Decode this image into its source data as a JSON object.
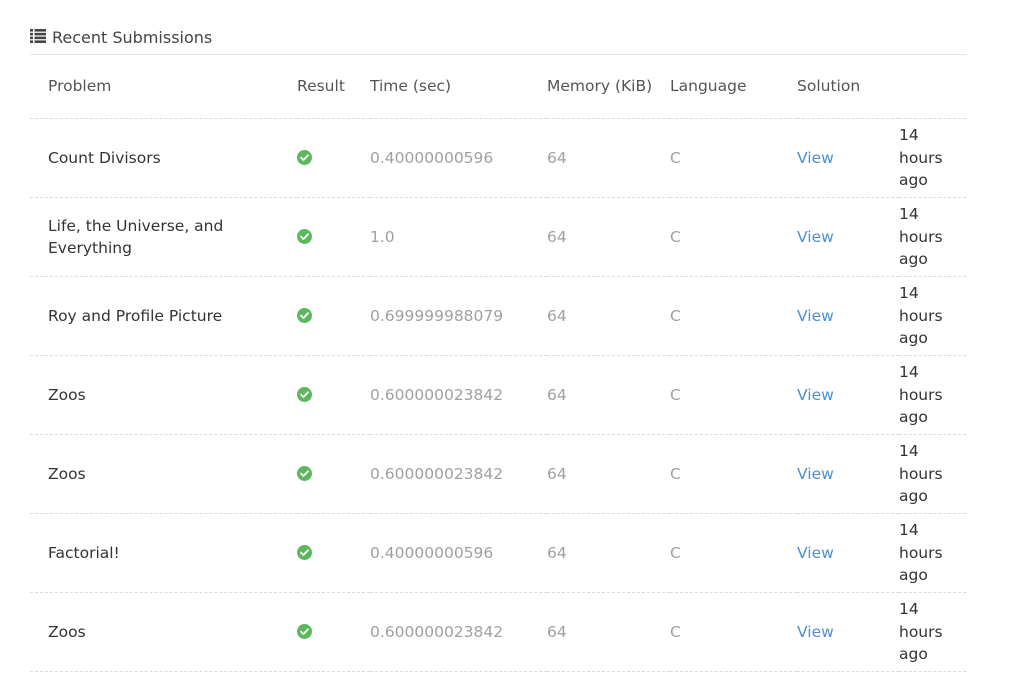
{
  "panel": {
    "title": "Recent Submissions",
    "icon": "list-icon"
  },
  "table": {
    "headers": {
      "problem": "Problem",
      "result": "Result",
      "time": "Time (sec)",
      "memory": "Memory (KiB)",
      "language": "Language",
      "solution": "Solution",
      "when": ""
    },
    "rows": [
      {
        "problem": "Count Divisors",
        "result": "accepted",
        "time": "0.40000000596",
        "memory": "64",
        "language": "C",
        "solution": "View",
        "when": "14 hours ago"
      },
      {
        "problem": "Life, the Universe, and Everything",
        "result": "accepted",
        "time": "1.0",
        "memory": "64",
        "language": "C",
        "solution": "View",
        "when": "14 hours ago"
      },
      {
        "problem": "Roy and Profile Picture",
        "result": "accepted",
        "time": "0.699999988079",
        "memory": "64",
        "language": "C",
        "solution": "View",
        "when": "14 hours ago"
      },
      {
        "problem": "Zoos",
        "result": "accepted",
        "time": "0.600000023842",
        "memory": "64",
        "language": "C",
        "solution": "View",
        "when": "14 hours ago"
      },
      {
        "problem": "Zoos",
        "result": "accepted",
        "time": "0.600000023842",
        "memory": "64",
        "language": "C",
        "solution": "View",
        "when": "14 hours ago"
      },
      {
        "problem": "Factorial!",
        "result": "accepted",
        "time": "0.40000000596",
        "memory": "64",
        "language": "C",
        "solution": "View",
        "when": "14 hours ago"
      },
      {
        "problem": "Zoos",
        "result": "accepted",
        "time": "0.600000023842",
        "memory": "64",
        "language": "C",
        "solution": "View",
        "when": "14 hours ago"
      }
    ]
  },
  "colors": {
    "accepted": "#5cb85c",
    "link": "#4a90d2",
    "muted": "#a0a0a0"
  },
  "icons": {
    "result_accepted": "check-circle-icon"
  }
}
